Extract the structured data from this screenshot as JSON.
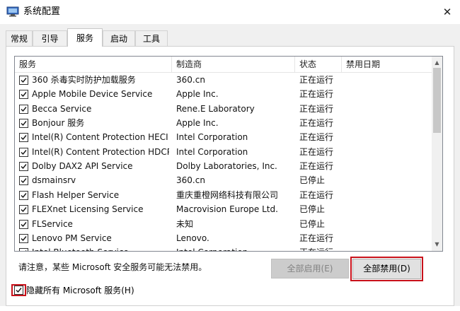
{
  "window": {
    "title": "系统配置",
    "close_glyph": "✕"
  },
  "tabs": [
    {
      "label": "常规",
      "active": false
    },
    {
      "label": "引导",
      "active": false
    },
    {
      "label": "服务",
      "active": true
    },
    {
      "label": "启动",
      "active": false
    },
    {
      "label": "工具",
      "active": false
    }
  ],
  "list": {
    "columns": [
      "服务",
      "制造商",
      "状态",
      "禁用日期"
    ],
    "rows": [
      {
        "checked": true,
        "name": "360 杀毒实时防护加载服务",
        "manufacturer": "360.cn",
        "status": "正在运行",
        "date": ""
      },
      {
        "checked": true,
        "name": "Apple Mobile Device Service",
        "manufacturer": "Apple Inc.",
        "status": "正在运行",
        "date": ""
      },
      {
        "checked": true,
        "name": "Becca Service",
        "manufacturer": "Rene.E Laboratory",
        "status": "正在运行",
        "date": ""
      },
      {
        "checked": true,
        "name": "Bonjour 服务",
        "manufacturer": "Apple Inc.",
        "status": "正在运行",
        "date": ""
      },
      {
        "checked": true,
        "name": "Intel(R) Content Protection HECI ...",
        "manufacturer": "Intel Corporation",
        "status": "正在运行",
        "date": ""
      },
      {
        "checked": true,
        "name": "Intel(R) Content Protection HDCP...",
        "manufacturer": "Intel Corporation",
        "status": "正在运行",
        "date": ""
      },
      {
        "checked": true,
        "name": "Dolby DAX2 API Service",
        "manufacturer": "Dolby Laboratories, Inc.",
        "status": "正在运行",
        "date": ""
      },
      {
        "checked": true,
        "name": "dsmainsrv",
        "manufacturer": "360.cn",
        "status": "已停止",
        "date": ""
      },
      {
        "checked": true,
        "name": "Flash Helper Service",
        "manufacturer": "重庆重橙网络科技有限公司",
        "status": "正在运行",
        "date": ""
      },
      {
        "checked": true,
        "name": "FLEXnet Licensing Service",
        "manufacturer": "Macrovision Europe Ltd.",
        "status": "已停止",
        "date": ""
      },
      {
        "checked": true,
        "name": "FLService",
        "manufacturer": "未知",
        "status": "已停止",
        "date": ""
      },
      {
        "checked": true,
        "name": "Lenovo PM Service",
        "manufacturer": "Lenovo.",
        "status": "正在运行",
        "date": ""
      },
      {
        "checked": true,
        "name": "Intel Bluetooth Service",
        "manufacturer": "Intel Corporation",
        "status": "正在运行",
        "date": ""
      }
    ],
    "scroll_position": 0.0,
    "scroll_visible_fraction": 0.5
  },
  "notice": "请注意，某些 Microsoft 安全服务可能无法禁用。",
  "buttons": {
    "enable_all": "全部启用(E)",
    "disable_all": "全部禁用(D)"
  },
  "hide_microsoft": {
    "label": "隐藏所有 Microsoft 服务(H)",
    "checked": true
  },
  "colors": {
    "highlight": "#c8111a",
    "disabled_text": "#838383"
  },
  "icons": {
    "app": "system-config-icon",
    "close": "close-icon",
    "check": "checkmark-icon"
  }
}
